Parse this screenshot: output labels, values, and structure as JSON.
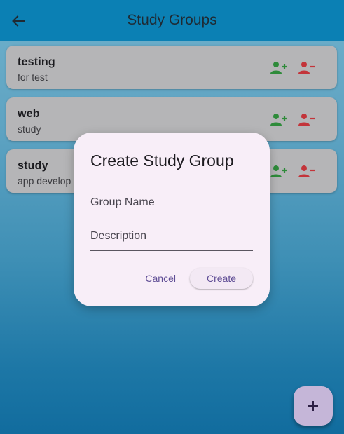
{
  "app_bar": {
    "title": "Study Groups",
    "back_icon": "arrow-back-icon"
  },
  "groups": [
    {
      "name": "testing",
      "description": "for test"
    },
    {
      "name": "web",
      "description": "study"
    },
    {
      "name": "study",
      "description": "app develop"
    }
  ],
  "actions": {
    "join_icon": "person-add-icon",
    "leave_icon": "person-remove-icon",
    "join_color": "#2e8b3a",
    "leave_color": "#c3343a"
  },
  "dialog": {
    "title": "Create Study Group",
    "group_name_placeholder": "Group Name",
    "group_name_value": "",
    "description_placeholder": "Description",
    "description_value": "",
    "cancel_label": "Cancel",
    "create_label": "Create"
  },
  "fab": {
    "icon": "plus-icon",
    "symbol": "+"
  },
  "colors": {
    "app_bar": "#0b80b4",
    "card": "#b5b5b7",
    "dialog_bg": "#f8eef8",
    "accent": "#5f4d95",
    "fab": "#c5b6d8"
  }
}
